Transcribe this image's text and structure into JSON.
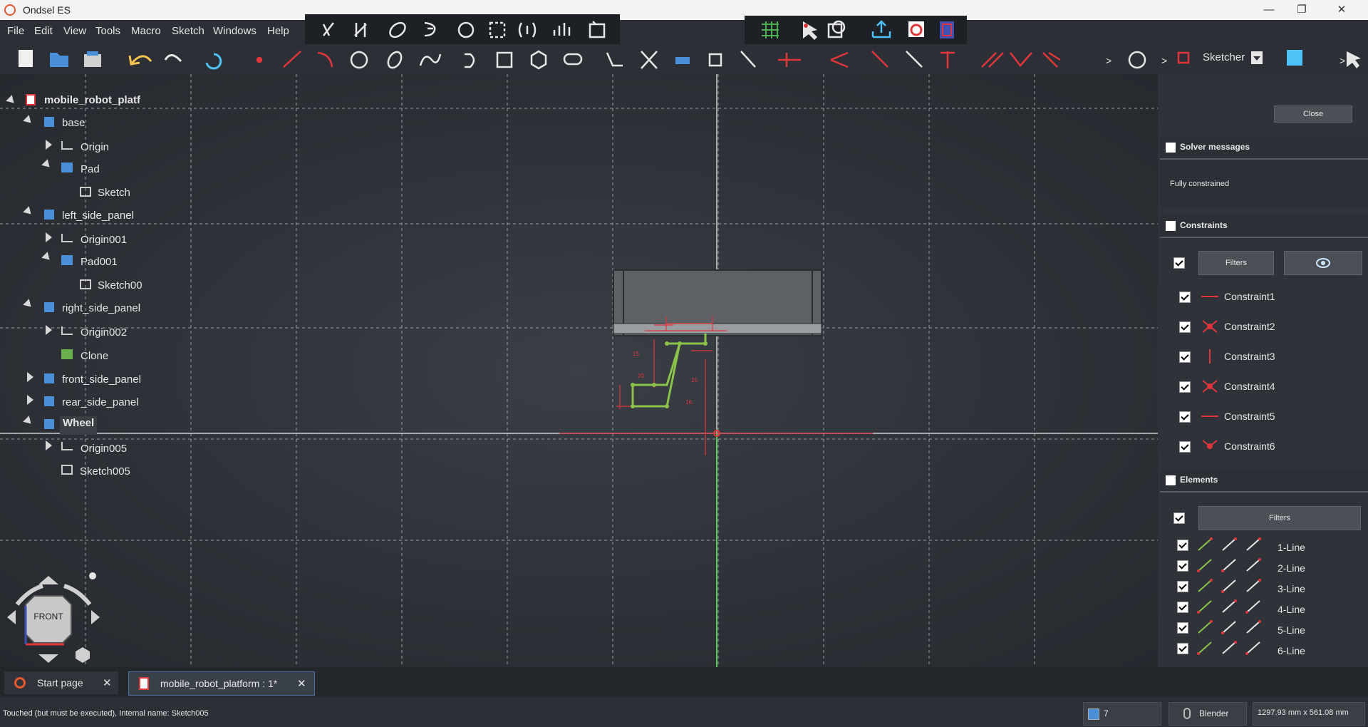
{
  "window": {
    "title": "Ondsel ES",
    "minimize": "—",
    "maximize": "❐",
    "close": "✕"
  },
  "menu": [
    "File",
    "Edit",
    "View",
    "Tools",
    "Macro",
    "Sketch",
    "Windows",
    "Help"
  ],
  "workbench": {
    "selected": "Sketcher"
  },
  "tree": {
    "root": "mobile_robot_platf",
    "items": [
      {
        "label": "base"
      },
      {
        "label": "Origin"
      },
      {
        "label": "Pad"
      },
      {
        "label": "Sketch"
      },
      {
        "label": "left_side_panel"
      },
      {
        "label": "Origin001"
      },
      {
        "label": "Pad001"
      },
      {
        "label": "Sketch00"
      },
      {
        "label": "right_side_panel"
      },
      {
        "label": "Origin002"
      },
      {
        "label": "Clone"
      },
      {
        "label": "front_side_panel"
      },
      {
        "label": "rear_side_panel"
      },
      {
        "label": "Wheel"
      },
      {
        "label": "Origin005"
      },
      {
        "label": "Sketch005"
      }
    ]
  },
  "navcube": {
    "face": "FRONT"
  },
  "task_panel": {
    "close_label": "Close",
    "solver": {
      "title": "Solver messages",
      "message": "Fully constrained"
    },
    "constraints": {
      "title": "Constraints",
      "filters_label": "Filters",
      "items": [
        "Constraint1",
        "Constraint2",
        "Constraint3",
        "Constraint4",
        "Constraint5",
        "Constraint6"
      ]
    },
    "elements": {
      "title": "Elements",
      "filters_label": "Filters",
      "items": [
        "1-Line",
        "2-Line",
        "3-Line",
        "4-Line",
        "5-Line",
        "6-Line"
      ]
    }
  },
  "dimensions": [
    "15",
    "20",
    "15",
    "16."
  ],
  "tabs": [
    {
      "label": "Start page",
      "close": "✕"
    },
    {
      "label": "mobile_robot_platform : 1*",
      "close": "✕"
    }
  ],
  "status": {
    "message": "Touched (but must be executed), Internal name: Sketch005",
    "counter": "7",
    "nav_style": "Blender",
    "dimensions": "1297.93 mm x 561.08 mm"
  },
  "colors": {
    "constraint_red": "#e0363b",
    "geometry_green": "#8bc34a",
    "axis_green": "#66ff66"
  }
}
